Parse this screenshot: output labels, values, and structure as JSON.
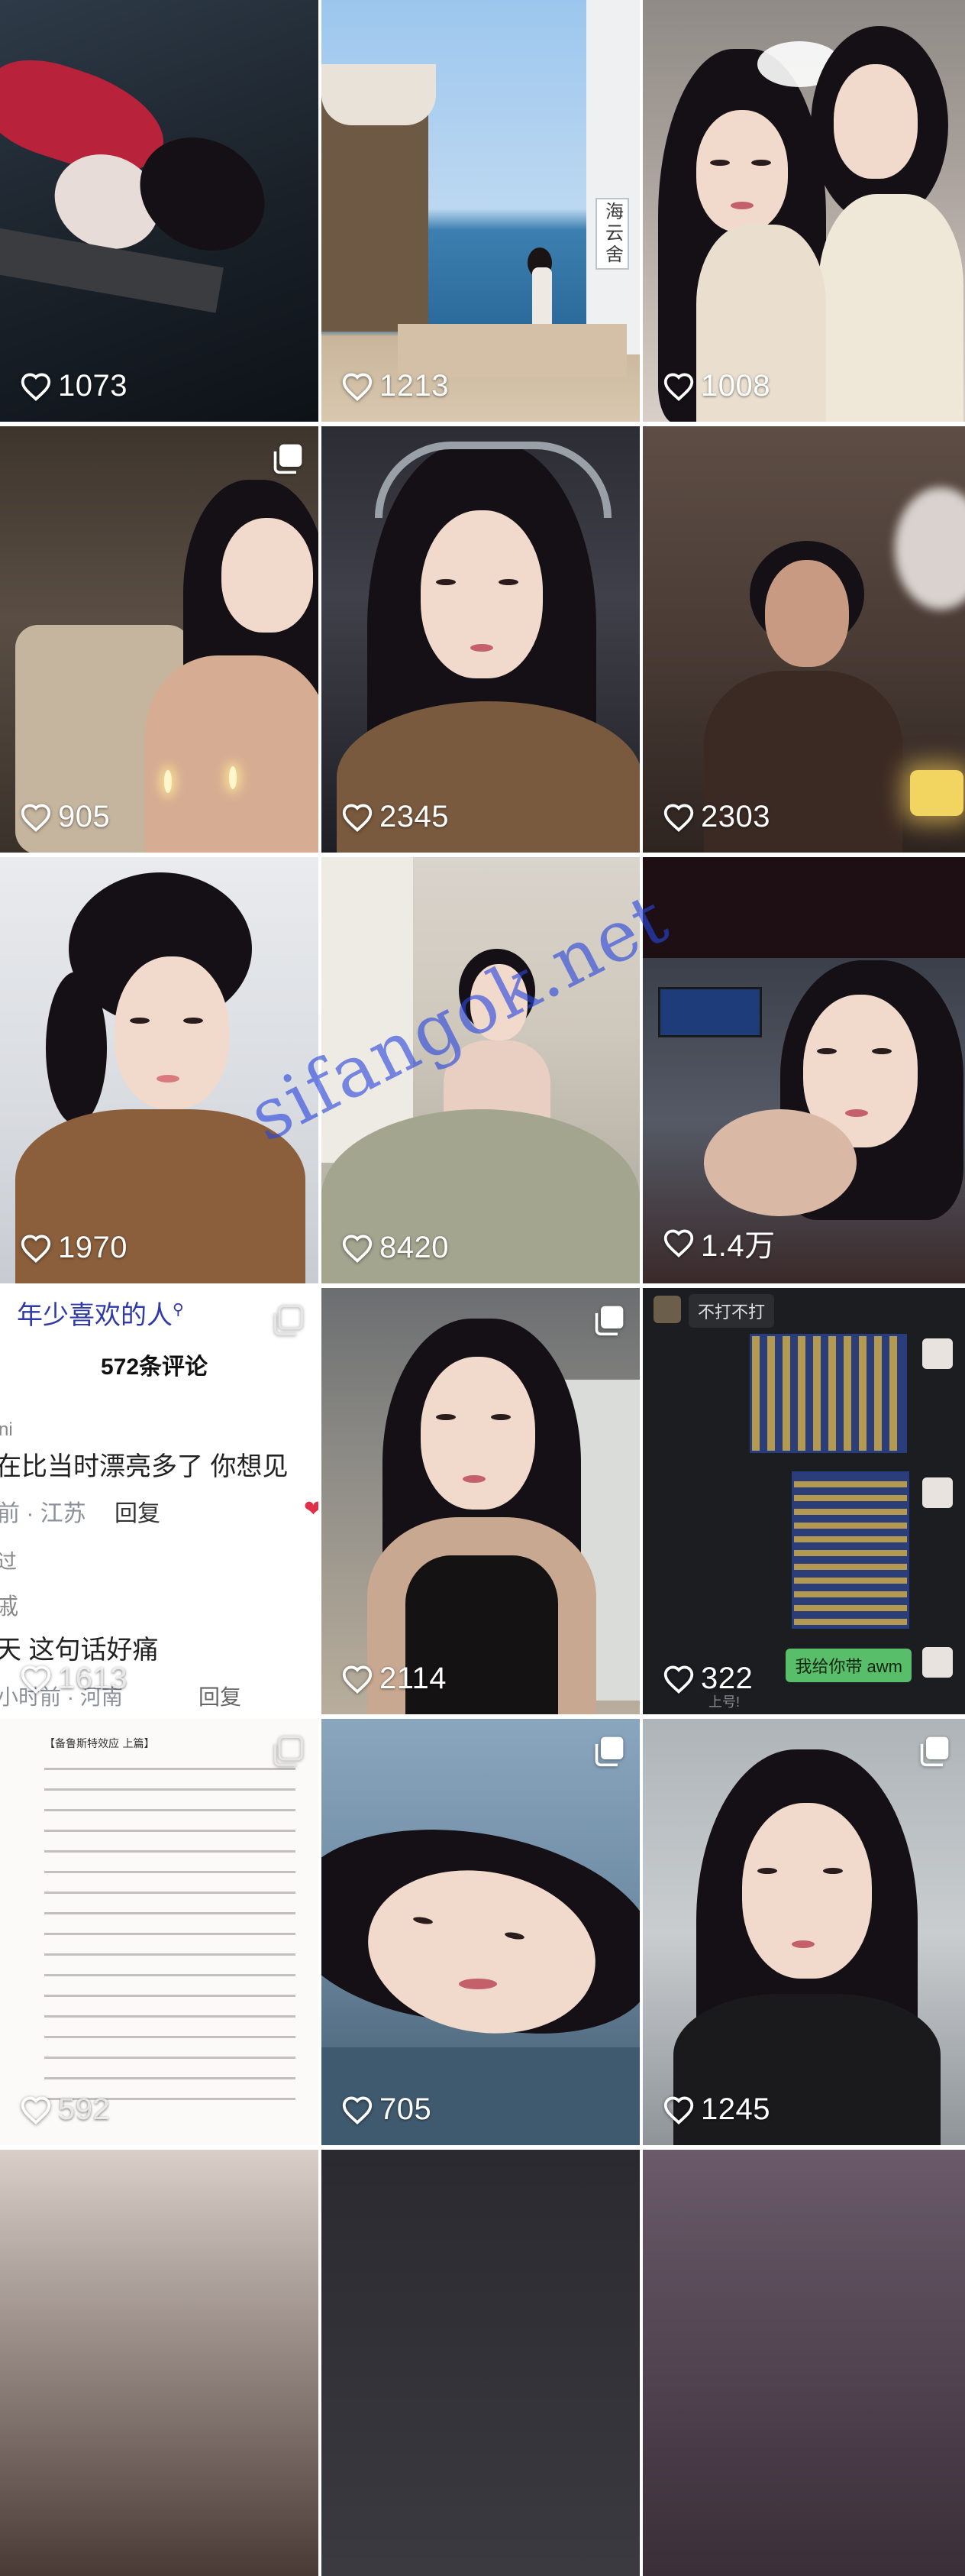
{
  "watermark": "sifangok.net",
  "posts": [
    {
      "likes": "1073",
      "multi": false
    },
    {
      "likes": "1213",
      "multi": false,
      "sign_text": "海云舍"
    },
    {
      "likes": "1008",
      "multi": false
    },
    {
      "likes": "905",
      "multi": true
    },
    {
      "likes": "2345",
      "multi": false
    },
    {
      "likes": "2303",
      "multi": false
    },
    {
      "likes": "1970",
      "multi": false
    },
    {
      "likes": "8420",
      "multi": false
    },
    {
      "likes": "1.4万",
      "multi": false
    },
    {
      "likes": "1613",
      "multi": true,
      "comment_title": "年少喜欢的人",
      "comment_count": "572条评论",
      "lines": [
        "ni",
        "在比当时漂亮多了 你想见",
        "前 · 江苏",
        "回复",
        "过",
        "戚",
        "天 这句话好痛",
        "小时前 · 河南",
        "回复"
      ]
    },
    {
      "likes": "2114",
      "multi": true
    },
    {
      "likes": "322",
      "multi": false,
      "chat_top": "不打不打",
      "chat_bottom": "我给你带 awm",
      "chat_sub": "上号!"
    },
    {
      "likes": "592",
      "multi": true,
      "novel_heading": "【备鲁斯特效应 上篇】"
    },
    {
      "likes": "705",
      "multi": true
    },
    {
      "likes": "1245",
      "multi": true
    }
  ]
}
